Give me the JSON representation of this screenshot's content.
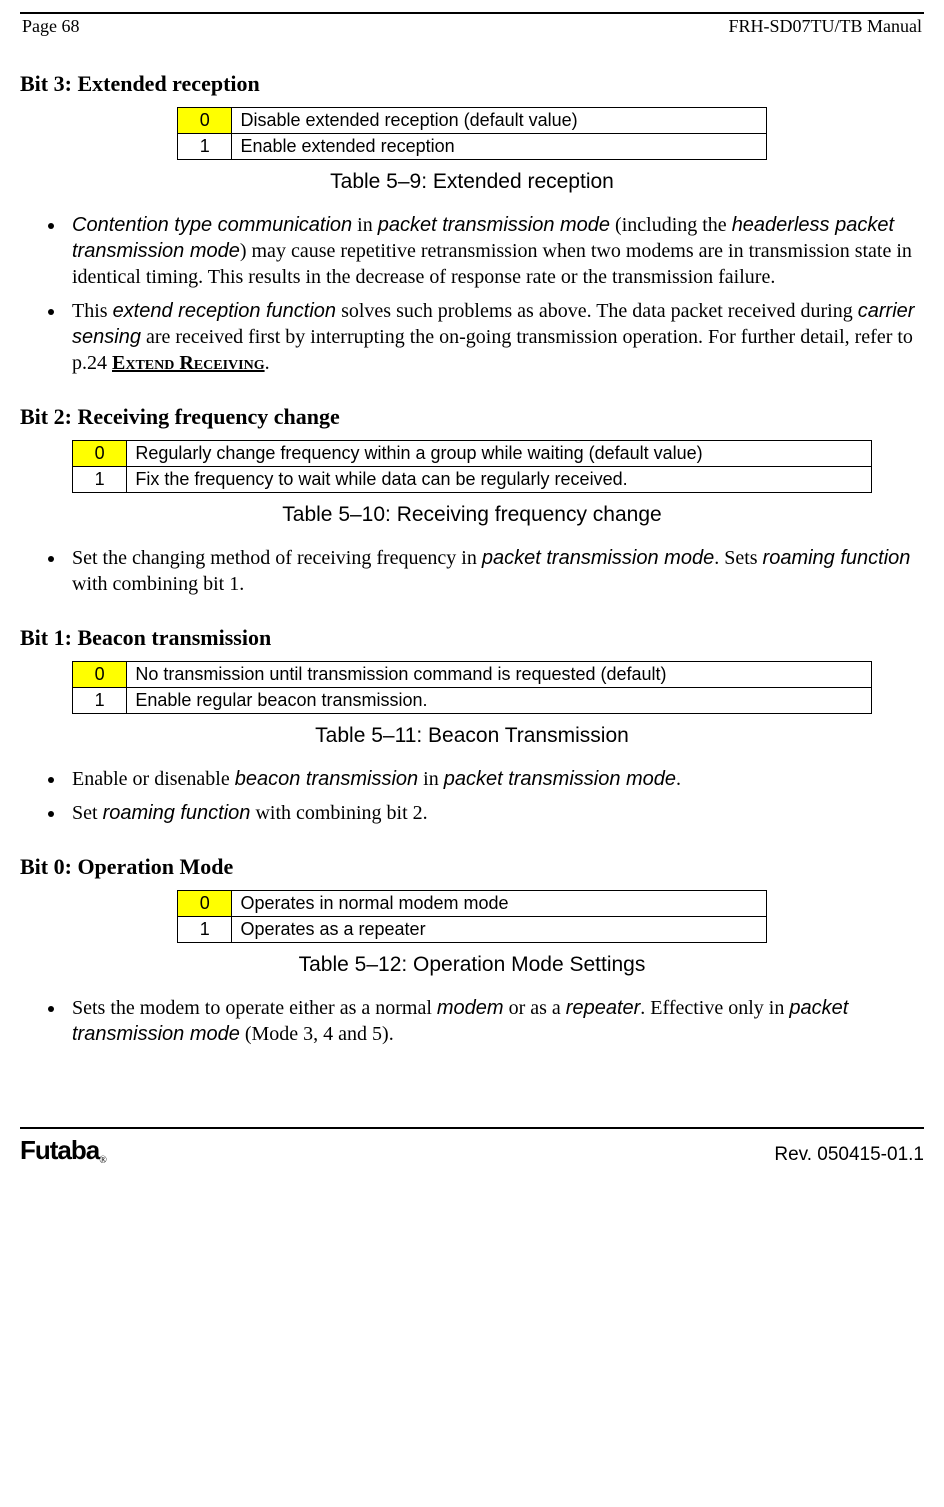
{
  "header": {
    "page_label": "Page  68",
    "manual_title": "FRH-SD07TU/TB Manual"
  },
  "bit3": {
    "heading": "Bit 3:  Extended reception",
    "row0_key": "0",
    "row0_desc": "Disable extended reception (default value)",
    "row1_key": "1",
    "row1_desc": "Enable extended reception",
    "caption": "Table 5–9:  Extended reception",
    "bullet1_a": "Contention type communication",
    "bullet1_b": " in ",
    "bullet1_c": "packet transmission mode",
    "bullet1_d": " (including the ",
    "bullet1_e": "headerless packet transmission mode",
    "bullet1_f": ") may cause repetitive retransmission when two modems are in transmission state in identical timing. This results in the decrease of response rate or the transmission failure.",
    "bullet2_a": "This ",
    "bullet2_b": "extend reception function",
    "bullet2_c": " solves such problems as above. The data packet received during ",
    "bullet2_d": "carrier sensing",
    "bullet2_e": " are received first by interrupting the on-going transmission operation. For further detail, refer to p.24 ",
    "bullet2_link": "Extend Receiving",
    "bullet2_f": "."
  },
  "bit2": {
    "heading": "Bit 2:  Receiving frequency change",
    "row0_key": "0",
    "row0_desc": "Regularly change frequency within a group while waiting (default value)",
    "row1_key": "1",
    "row1_desc": "Fix the frequency to wait while data can be regularly received.",
    "caption": "Table 5–10:  Receiving frequency change",
    "bullet1_a": "Set the changing method of receiving frequency in ",
    "bullet1_b": "packet transmission mode",
    "bullet1_c": ". Sets ",
    "bullet1_d": "roaming function",
    "bullet1_e": " with combining bit 1."
  },
  "bit1": {
    "heading": "Bit 1:  Beacon transmission",
    "row0_key": "0",
    "row0_desc": "No transmission until transmission command is requested (default)",
    "row1_key": "1",
    "row1_desc": "Enable regular beacon transmission.",
    "caption": "Table 5–11:  Beacon Transmission",
    "bullet1_a": "Enable or disenable ",
    "bullet1_b": "beacon transmission",
    "bullet1_c": " in ",
    "bullet1_d": "packet transmission mode",
    "bullet1_e": ".",
    "bullet2_a": "Set ",
    "bullet2_b": "roaming function",
    "bullet2_c": " with combining bit 2."
  },
  "bit0": {
    "heading": "Bit 0:  Operation Mode",
    "row0_key": "0",
    "row0_desc": "Operates in normal modem mode",
    "row1_key": "1",
    "row1_desc": "Operates as a repeater",
    "caption": "Table 5–12:  Operation Mode Settings",
    "bullet1_a": "Sets the modem to operate either as a normal ",
    "bullet1_b": "modem",
    "bullet1_c": " or as a ",
    "bullet1_d": "repeater",
    "bullet1_e": ". Effective only in ",
    "bullet1_f": "packet transmission mode",
    "bullet1_g": " (Mode 3, 4 and 5)."
  },
  "footer": {
    "logo": "Futaba",
    "logo_r": "®",
    "rev": "Rev. 050415-01.1"
  }
}
